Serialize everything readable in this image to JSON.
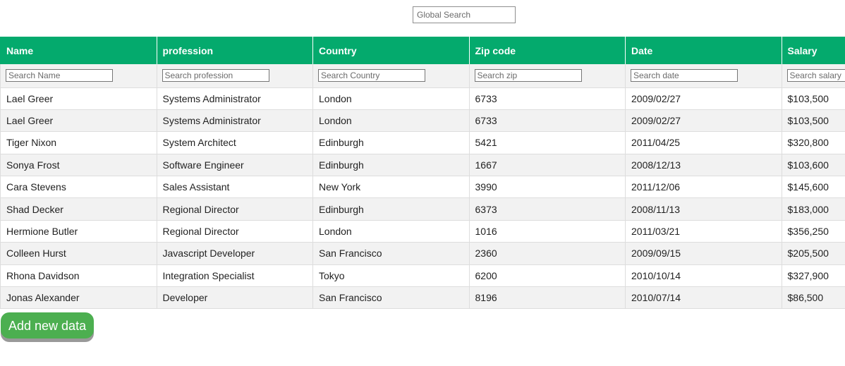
{
  "global_search": {
    "placeholder": "Global Search",
    "value": ""
  },
  "table": {
    "columns": [
      {
        "label": "Name",
        "filter_placeholder": "Search Name"
      },
      {
        "label": "profession",
        "filter_placeholder": "Search profession"
      },
      {
        "label": "Country",
        "filter_placeholder": "Search Country"
      },
      {
        "label": "Zip code",
        "filter_placeholder": "Search zip"
      },
      {
        "label": "Date",
        "filter_placeholder": "Search date"
      },
      {
        "label": "Salary",
        "filter_placeholder": "Search salary"
      }
    ],
    "rows": [
      [
        "Lael Greer",
        "Systems Administrator",
        "London",
        "6733",
        "2009/02/27",
        "$103,500"
      ],
      [
        "Lael Greer",
        "Systems Administrator",
        "London",
        "6733",
        "2009/02/27",
        "$103,500"
      ],
      [
        "Tiger Nixon",
        "System Architect",
        "Edinburgh",
        "5421",
        "2011/04/25",
        "$320,800"
      ],
      [
        "Sonya Frost",
        "Software Engineer",
        "Edinburgh",
        "1667",
        "2008/12/13",
        "$103,600"
      ],
      [
        "Cara Stevens",
        "Sales Assistant",
        "New York",
        "3990",
        "2011/12/06",
        "$145,600"
      ],
      [
        "Shad Decker",
        "Regional Director",
        "Edinburgh",
        "6373",
        "2008/11/13",
        "$183,000"
      ],
      [
        "Hermione Butler",
        "Regional Director",
        "London",
        "1016",
        "2011/03/21",
        "$356,250"
      ],
      [
        "Colleen Hurst",
        "Javascript Developer",
        "San Francisco",
        "2360",
        "2009/09/15",
        "$205,500"
      ],
      [
        "Rhona Davidson",
        "Integration Specialist",
        "Tokyo",
        "6200",
        "2010/10/14",
        "$327,900"
      ],
      [
        "Jonas Alexander",
        "Developer",
        "San Francisco",
        "8196",
        "2010/07/14",
        "$86,500"
      ]
    ]
  },
  "add_button": {
    "label": "Add new data"
  },
  "colors": {
    "header_bg": "#04aa6d",
    "header_text": "#ffffff",
    "row_alt_bg": "#f2f2f2",
    "button_bg": "#4caf50",
    "button_shadow": "#999999"
  }
}
